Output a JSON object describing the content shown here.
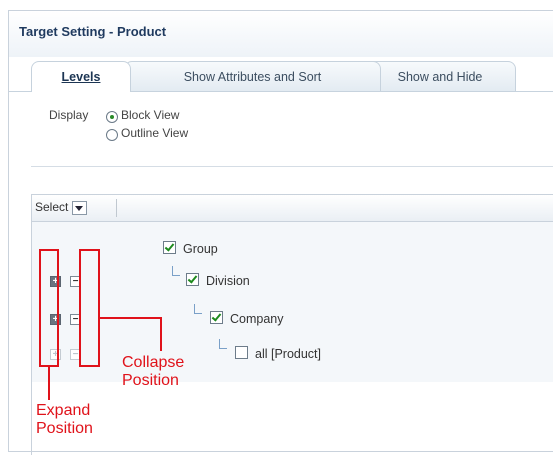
{
  "window": {
    "title": "Target Setting - Product"
  },
  "tabs": [
    {
      "label": "Levels",
      "active": true
    },
    {
      "label": "Show Attributes and Sort",
      "active": false
    },
    {
      "label": "Show and Hide",
      "active": false
    }
  ],
  "display": {
    "label": "Display",
    "options": [
      {
        "label": "Block View",
        "selected": true
      },
      {
        "label": "Outline View",
        "selected": false
      }
    ]
  },
  "toolbar": {
    "select_label": "Select"
  },
  "tree": [
    {
      "label": "Group",
      "checked": true
    },
    {
      "label": "Division",
      "checked": true
    },
    {
      "label": "Company",
      "checked": true
    },
    {
      "label": "all [Product]",
      "checked": false
    }
  ],
  "annotations": {
    "collapse_line1": "Collapse",
    "collapse_line2": "Position",
    "expand_line1": "Expand",
    "expand_line2": "Position"
  },
  "colors": {
    "annotation": "#e0121a",
    "check": "#1d8a1d",
    "title": "#1f3a5f"
  }
}
